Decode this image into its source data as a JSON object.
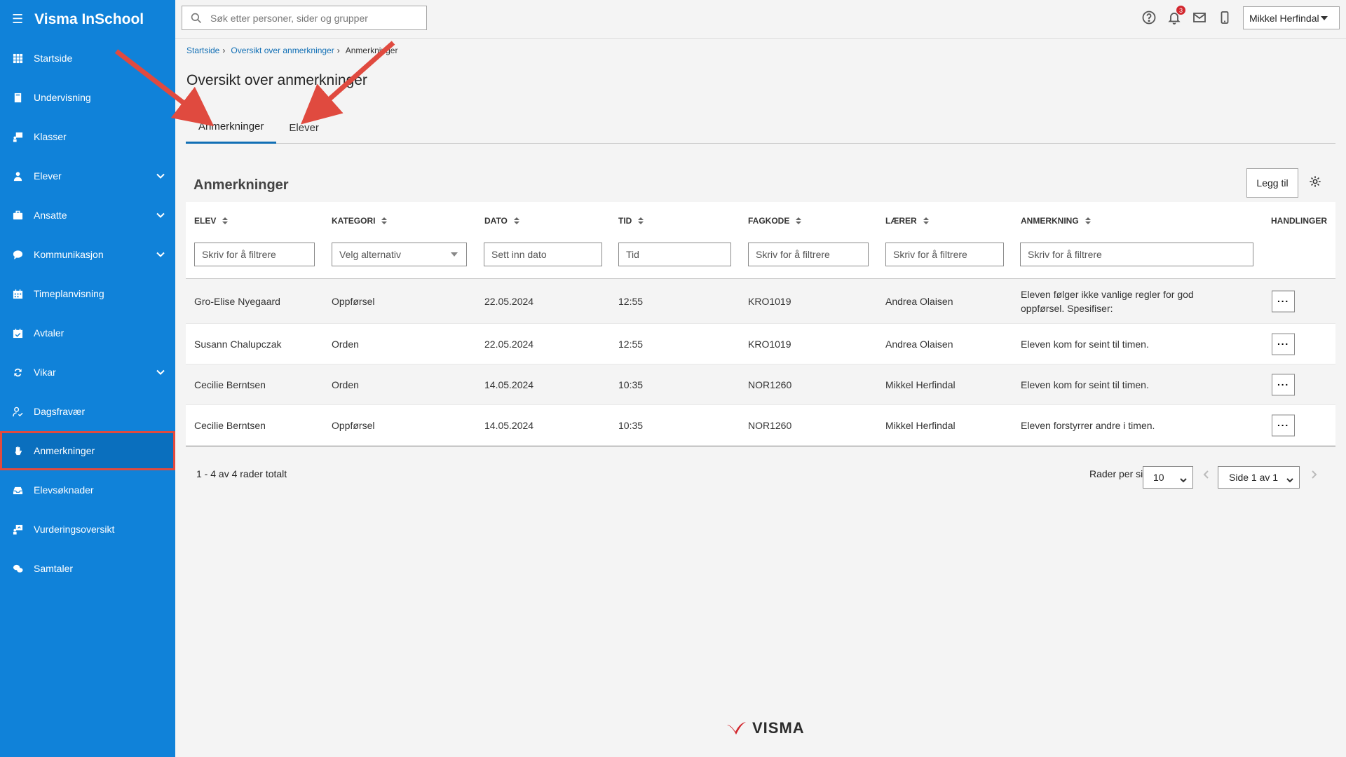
{
  "app": {
    "title": "Visma InSchool"
  },
  "sidebar": {
    "items": [
      {
        "label": "Startside",
        "icon": "grid-icon",
        "expandable": false
      },
      {
        "label": "Undervisning",
        "icon": "book-icon",
        "expandable": false
      },
      {
        "label": "Klasser",
        "icon": "classroom-icon",
        "expandable": false
      },
      {
        "label": "Elever",
        "icon": "student-icon",
        "expandable": true
      },
      {
        "label": "Ansatte",
        "icon": "briefcase-icon",
        "expandable": true
      },
      {
        "label": "Kommunikasjon",
        "icon": "chat-bubble-icon",
        "expandable": true
      },
      {
        "label": "Timeplanvisning",
        "icon": "calendar-icon",
        "expandable": false
      },
      {
        "label": "Avtaler",
        "icon": "calendar-check-icon",
        "expandable": false
      },
      {
        "label": "Vikar",
        "icon": "swap-icon",
        "expandable": true
      },
      {
        "label": "Dagsfravær",
        "icon": "user-absence-icon",
        "expandable": false
      },
      {
        "label": "Anmerkninger",
        "icon": "hand-icon",
        "expandable": false,
        "active": true
      },
      {
        "label": "Elevsøknader",
        "icon": "inbox-icon",
        "expandable": false
      },
      {
        "label": "Vurderingsoversikt",
        "icon": "assessment-icon",
        "expandable": false
      },
      {
        "label": "Samtaler",
        "icon": "conversation-icon",
        "expandable": false
      }
    ]
  },
  "header": {
    "search_placeholder": "Søk etter personer, sider og grupper",
    "notification_count": "3",
    "user_name": "Mikkel Herfindal"
  },
  "breadcrumb": {
    "items": [
      "Startside",
      "Oversikt over anmerkninger"
    ],
    "current": "Anmerkninger"
  },
  "page": {
    "title": "Oversikt over anmerkninger",
    "tabs": [
      {
        "label": "Anmerkninger",
        "active": true
      },
      {
        "label": "Elever",
        "active": false
      }
    ],
    "section_title": "Anmerkninger",
    "add_label": "Legg til"
  },
  "table": {
    "columns": [
      "ELEV",
      "KATEGORI",
      "DATO",
      "TID",
      "FAGKODE",
      "LÆRER",
      "ANMERKNING",
      "HANDLINGER"
    ],
    "filters": {
      "elev": "Skriv for å filtrere",
      "kategori": "Velg alternativ",
      "dato": "Sett inn dato",
      "tid": "Tid",
      "fagkode": "Skriv for å filtrere",
      "laerer": "Skriv for å filtrere",
      "anmerkning": "Skriv for å filtrere"
    },
    "rows": [
      {
        "elev": "Gro-Elise Nyegaard",
        "kategori": "Oppførsel",
        "dato": "22.05.2024",
        "tid": "12:55",
        "fagkode": "KRO1019",
        "laerer": "Andrea Olaisen",
        "anmerkning": "Eleven følger ikke vanlige regler for god oppførsel. Spesifiser:"
      },
      {
        "elev": "Susann Chalupczak",
        "kategori": "Orden",
        "dato": "22.05.2024",
        "tid": "12:55",
        "fagkode": "KRO1019",
        "laerer": "Andrea Olaisen",
        "anmerkning": "Eleven kom for seint til timen."
      },
      {
        "elev": "Cecilie Berntsen",
        "kategori": "Orden",
        "dato": "14.05.2024",
        "tid": "10:35",
        "fagkode": "NOR1260",
        "laerer": "Mikkel Herfindal",
        "anmerkning": "Eleven kom for seint til timen."
      },
      {
        "elev": "Cecilie Berntsen",
        "kategori": "Oppførsel",
        "dato": "14.05.2024",
        "tid": "10:35",
        "fagkode": "NOR1260",
        "laerer": "Mikkel Herfindal",
        "anmerkning": "Eleven forstyrrer andre i timen."
      }
    ],
    "actions_label": "···"
  },
  "pager": {
    "total_text": "1 - 4 av 4 rader totalt",
    "rows_per_page_label": "Rader per side",
    "rows_per_page": "10",
    "page_text": "Side 1 av 1"
  },
  "footer": {
    "logo_text": "VISMA"
  },
  "colors": {
    "sidebar": "#1082d9",
    "accent": "#116fb5",
    "annotation": "#e04a3f",
    "brand_red": "#d2272e"
  }
}
